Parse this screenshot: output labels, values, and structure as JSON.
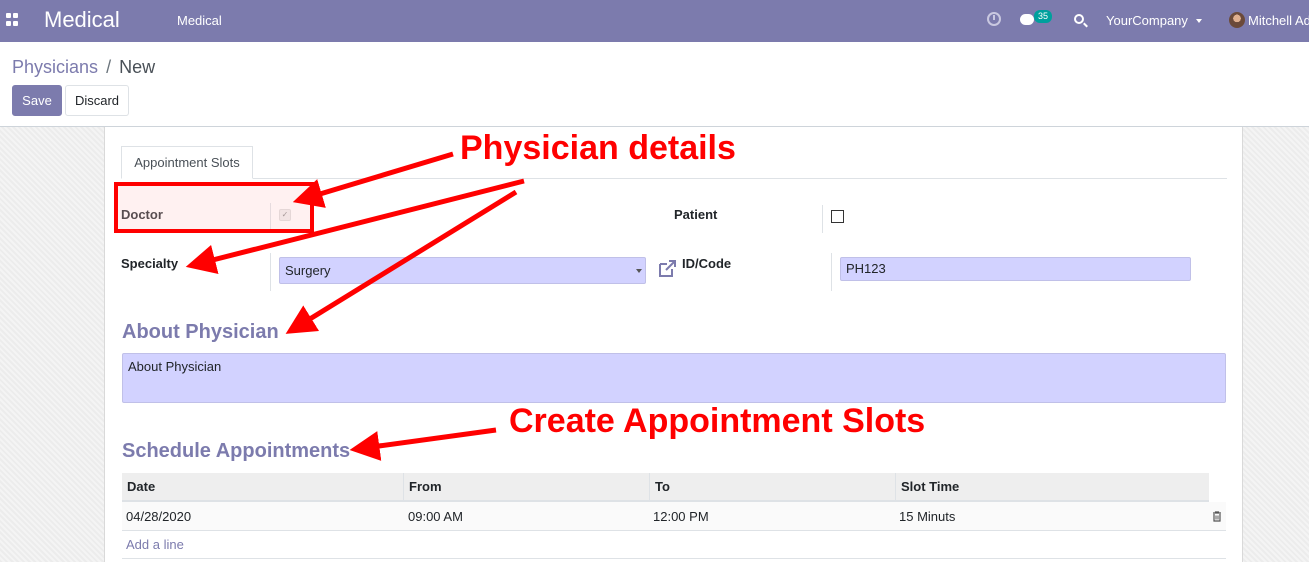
{
  "navbar": {
    "brand": "Medical",
    "menu_item": "Medical",
    "messages_badge": "35",
    "company": "YourCompany",
    "user": "Mitchell Ad",
    "bg_color": "#7c7bad"
  },
  "breadcrumb": {
    "parent": "Physicians",
    "separator": "/",
    "current": "New"
  },
  "buttons": {
    "save": "Save",
    "discard": "Discard"
  },
  "tab": {
    "label": "Appointment Slots"
  },
  "form": {
    "doctor_label": "Doctor",
    "doctor_checked": true,
    "patient_label": "Patient",
    "patient_checked": false,
    "specialty_label": "Specialty",
    "specialty_value": "Surgery",
    "idcode_label": "ID/Code",
    "idcode_value": "PH123",
    "about_title": "About Physician",
    "about_placeholder": "About Physician",
    "schedule_title": "Schedule Appointments"
  },
  "table": {
    "columns": [
      "Date",
      "From",
      "To",
      "Slot Time"
    ],
    "rows": [
      {
        "date": "04/28/2020",
        "from": "09:00 AM",
        "to": "12:00 PM",
        "slot": "15 Minuts"
      }
    ],
    "add_line": "Add a line"
  },
  "annotations": {
    "physician_details": "Physician details",
    "create_slots": "Create Appointment Slots",
    "color": "#ff0000"
  }
}
